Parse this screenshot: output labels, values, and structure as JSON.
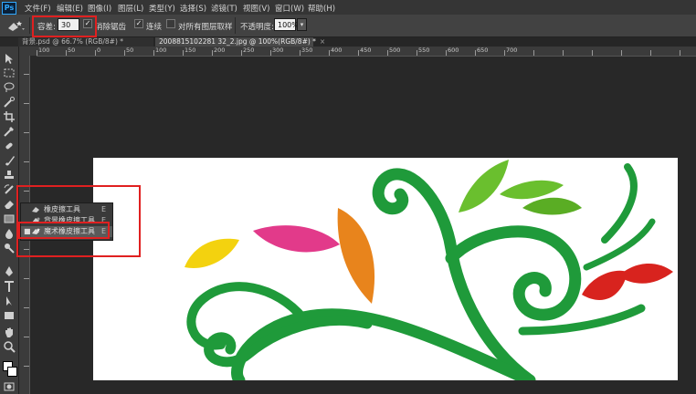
{
  "app": {
    "logo": "Ps"
  },
  "menu": [
    {
      "id": "file",
      "label": "文件(F)"
    },
    {
      "id": "edit",
      "label": "编辑(E)"
    },
    {
      "id": "image",
      "label": "图像(I)"
    },
    {
      "id": "layer",
      "label": "图层(L)"
    },
    {
      "id": "type",
      "label": "类型(Y)"
    },
    {
      "id": "select",
      "label": "选择(S)"
    },
    {
      "id": "filter",
      "label": "滤镜(T)"
    },
    {
      "id": "view",
      "label": "视图(V)"
    },
    {
      "id": "window",
      "label": "窗口(W)"
    },
    {
      "id": "help",
      "label": "帮助(H)"
    }
  ],
  "options": {
    "tolerance_label": "容差:",
    "tolerance_value": "30",
    "antialias_label": "消除锯齿",
    "antialias_checked": true,
    "contiguous_label": "连续",
    "contiguous_checked": true,
    "sample_all_label": "对所有图层取样",
    "sample_all_checked": false,
    "opacity_label": "不透明度:",
    "opacity_value": "100%"
  },
  "tabs": [
    {
      "label": "背景.psd @ 66.7% (RGB/8#) *",
      "close": "×"
    },
    {
      "label": "2008815102281 32_2.jpg @ 100%(RGB/8#) *",
      "close": "×"
    }
  ],
  "ruler_top_ticks": [
    "100",
    "50",
    "0",
    "50",
    "100",
    "150",
    "200",
    "250",
    "300",
    "350",
    "400",
    "450",
    "500",
    "550",
    "600",
    "650",
    "700"
  ],
  "flyout": {
    "items": [
      {
        "label": "橡皮擦工具",
        "key": "E",
        "selected": false
      },
      {
        "label": "背景橡皮擦工具",
        "key": "E",
        "selected": false
      },
      {
        "label": "魔术橡皮擦工具",
        "key": "E",
        "selected": true
      }
    ]
  },
  "colors": {
    "accent": "#31a8ff",
    "highlight": "#e02020",
    "leaf_green": "#1f9a3a",
    "leaf_light_green": "#6abf2e",
    "leaf_orange": "#e8841c",
    "leaf_yellow": "#f3d20f",
    "leaf_pink": "#e23a8a",
    "leaf_red": "#d8231e"
  }
}
